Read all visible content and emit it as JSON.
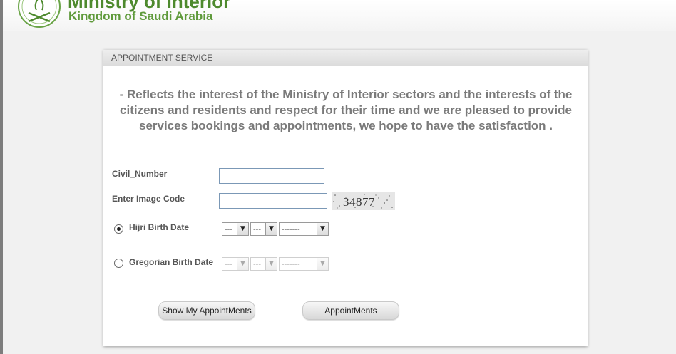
{
  "header": {
    "title": "Ministry of Interior",
    "subtitle": "Kingdom of Saudi Arabia",
    "brand_color": "#4e8a2e",
    "logo_icon": "saudi-emblem-icon"
  },
  "panel": {
    "title": "APPOINTMENT SERVICE",
    "intro": "- Reflects the interest of the Ministry of Interior sectors and the interests of the citizens and residents and respect for their time and we are pleased to provide services bookings and appointments, we hope to have the satisfaction ."
  },
  "form": {
    "civil_number_label": "Civil_Number",
    "civil_number_value": "",
    "image_code_label": "Enter Image Code",
    "image_code_value": "",
    "captcha_text": "34877",
    "hijri": {
      "label": "Hijri Birth Date",
      "selected": true,
      "day": "---",
      "month": "---",
      "year": "-------"
    },
    "gregorian": {
      "label": "Gregorian Birth Date",
      "selected": false,
      "day": "---",
      "month": "---",
      "year": "-------"
    }
  },
  "buttons": {
    "show_my_appointments": "Show My AppointMents",
    "appointments": "AppointMents"
  }
}
